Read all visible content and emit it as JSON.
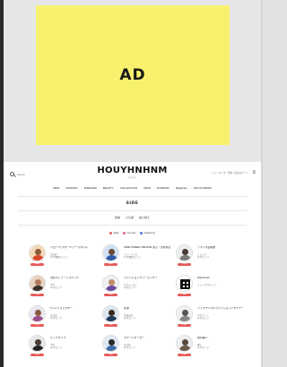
{
  "ad": {
    "label": "AD",
    "color": "#f8f16e"
  },
  "header": {
    "search_placeholder": "search",
    "logo": "HOUYHNHNM",
    "logo_sub": "フイナム",
    "right_text": "ニュースレター登録 / 会員ログイン",
    "right_icon": "menu-icon"
  },
  "nav": {
    "items": [
      "NEW",
      "FASHION",
      "SNEAKER",
      "BEAUTY",
      "COLLECTION",
      "SNAP",
      "RANKING",
      "Magazine",
      "HOUYHNHNM"
    ]
  },
  "page_title": "SIDE",
  "sort": {
    "items": [
      "新着",
      "人気順",
      "並び替え"
    ]
  },
  "legend": {
    "items": [
      {
        "label": "Male",
        "color": "#e85a5a"
      },
      {
        "label": "Female",
        "color": "#e05f9d"
      },
      {
        "label": "Influencer",
        "color": "#4b77d1"
      }
    ]
  },
  "cards": [
    {
      "name": "ハロー/ミスター/ヘアースタイル",
      "meta1": "会社員",
      "meta2": "年代/職業/エリア",
      "badge": "SNAP",
      "avatar": {
        "bg": "#f3d9b5",
        "skin": "#8a5a3a",
        "cloth": "#d9472b"
      },
      "col": 0,
      "row": 0
    },
    {
      "name": "SIDE STREET PEOPLE 東京・渋谷周辺",
      "meta1": "フリーランス",
      "meta2": "年代/職業/エリア",
      "badge": "SNAP",
      "avatar": {
        "bg": "#cfe1f2",
        "skin": "#6b4a3a",
        "cloth": "#2d5aa8"
      },
      "col": 1,
      "row": 0
    },
    {
      "name": "アメリカ古着屋",
      "meta1": "ショップ",
      "meta2": "年代/エリア",
      "badge": "SNAP",
      "avatar": {
        "bg": "#eeeeee",
        "skin": "#4a3a33",
        "cloth": "#7a7a7a"
      },
      "col": 2,
      "row": 0
    },
    {
      "name": "渋谷ストリートスナップ",
      "meta1": "学生",
      "meta2": "年代/エリア",
      "badge": "SNAP",
      "avatar": {
        "bg": "#e8d2c2",
        "skin": "#b47b5a",
        "cloth": "#39302a"
      },
      "col": 0,
      "row": 1
    },
    {
      "name": "ファッションフリーランサー",
      "meta1": "スタイリスト",
      "meta2": "年代/エリア",
      "badge": "SNAP",
      "avatar": {
        "bg": "#f0f0f0",
        "skin": "#c08a6a",
        "cloth": "#6a4aa0"
      },
      "col": 1,
      "row": 1
    },
    {
      "name": "Nikeshoe3",
      "meta1": "ショップ/スタッフ",
      "meta2": "",
      "badge": "SNAP",
      "avatar": {
        "bg": "#ffffff",
        "skin": "#111111",
        "cloth": "#111111",
        "qr": true
      },
      "col": 2,
      "row": 1
    },
    {
      "name": "Tシャツコレクター",
      "meta1": "会社員",
      "meta2": "年代/エリア",
      "badge": "SNAP",
      "avatar": {
        "bg": "#e9e6f2",
        "skin": "#8a5a3a",
        "cloth": "#a04a8a"
      },
      "col": 0,
      "row": 2
    },
    {
      "name": "原宿",
      "meta1": "古着店員",
      "meta2": "年代/エリア",
      "badge": "SNAP",
      "avatar": {
        "bg": "#dde6ef",
        "skin": "#3a2a22",
        "cloth": "#1f3a5a"
      },
      "col": 1,
      "row": 2
    },
    {
      "name": "アップサイクルファッションデザイナー",
      "meta1": "デザイナー",
      "meta2": "年代/エリア",
      "badge": "SNAP",
      "avatar": {
        "bg": "#f0f0f0",
        "skin": "#555555",
        "cloth": "#888888"
      },
      "col": 2,
      "row": 2
    },
    {
      "name": "ヒップホップ",
      "meta1": "学生",
      "meta2": "年代/エリア",
      "badge": "SNAP",
      "avatar": {
        "bg": "#e6e6e6",
        "skin": "#4a3a33",
        "cloth": "#222222"
      },
      "col": 0,
      "row": 3
    },
    {
      "name": "スケートボーダー",
      "meta1": "会社員",
      "meta2": "年代/エリア",
      "badge": "SNAP",
      "avatar": {
        "bg": "#dfe9f4",
        "skin": "#2a2a2a",
        "cloth": "#3a6aa8"
      },
      "col": 1,
      "row": 3
    },
    {
      "name": "靴の職人",
      "meta1": "職人",
      "meta2": "年代/エリア",
      "badge": "SNAP",
      "avatar": {
        "bg": "#eeeeee",
        "skin": "#5a4a40",
        "cloth": "#6a5a48"
      },
      "col": 2,
      "row": 3
    }
  ]
}
